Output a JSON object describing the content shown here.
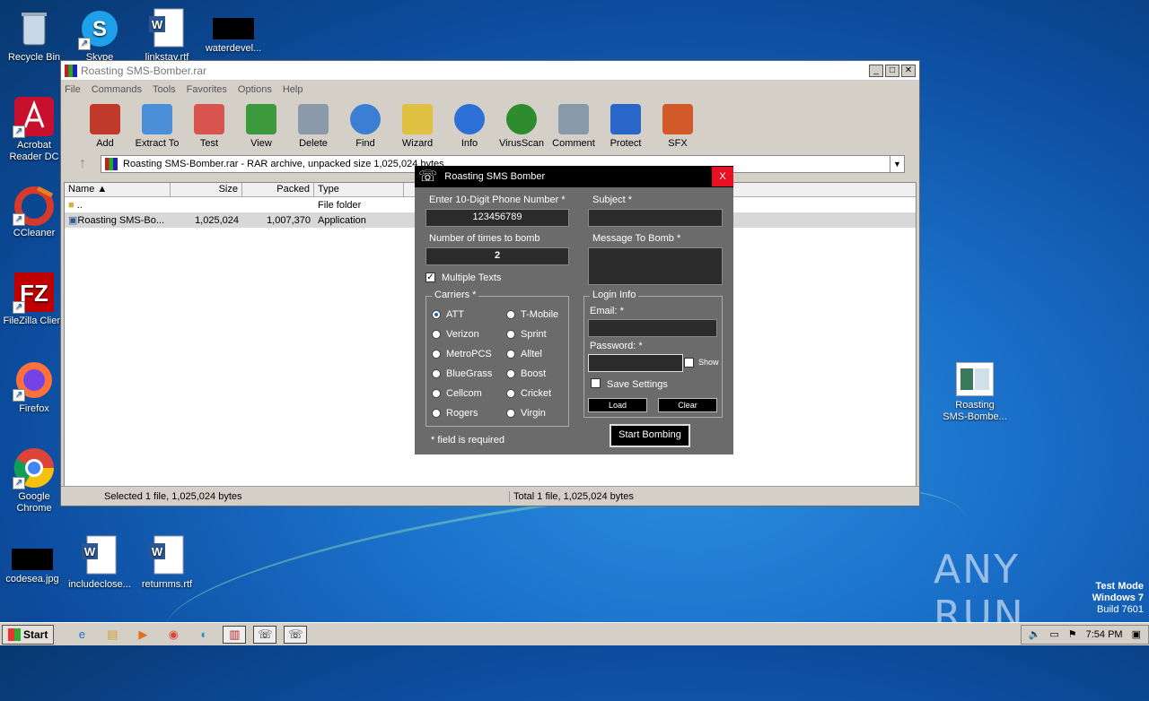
{
  "desktop": {
    "icons": [
      {
        "label": "Recycle Bin"
      },
      {
        "label": "Skype"
      },
      {
        "label": "linkstay.rtf"
      },
      {
        "label": "waterdevel..."
      },
      {
        "label": "Acrobat Reader DC"
      },
      {
        "label": "CCleaner"
      },
      {
        "label": "FileZilla Client"
      },
      {
        "label": "Firefox"
      },
      {
        "label": "Google Chrome"
      },
      {
        "label": "codesea.jpg"
      },
      {
        "label": "includeclose..."
      },
      {
        "label": "returnms.rtf"
      },
      {
        "label": "Roasting SMS-Bombe..."
      }
    ],
    "watermark": "ANY RUN",
    "test_mode": {
      "line1": "Test Mode",
      "line2": "Windows 7",
      "line3": "Build 7601"
    }
  },
  "winrar": {
    "title": "Roasting SMS-Bomber.rar",
    "window_buttons": [
      "_",
      "□",
      "✕"
    ],
    "menu": [
      "File",
      "Commands",
      "Tools",
      "Favorites",
      "Options",
      "Help"
    ],
    "toolbar": [
      {
        "label": "Add",
        "color": "#c0392b"
      },
      {
        "label": "Extract To",
        "color": "#4a8fd8"
      },
      {
        "label": "Test",
        "color": "#d9534f"
      },
      {
        "label": "View",
        "color": "#3c9a3c"
      },
      {
        "label": "Delete",
        "color": "#8a9aa8"
      },
      {
        "label": "Find",
        "color": "#3b7fd4"
      },
      {
        "label": "Wizard",
        "color": "#e0c040"
      },
      {
        "label": "Info",
        "color": "#2c6fd6"
      },
      {
        "label": "VirusScan",
        "color": "#2e8b2e"
      },
      {
        "label": "Comment",
        "color": "#8899aa"
      },
      {
        "label": "Protect",
        "color": "#2a66c8"
      },
      {
        "label": "SFX",
        "color": "#d25a2a"
      }
    ],
    "address": "Roasting SMS-Bomber.rar - RAR archive, unpacked size 1,025,024 bytes",
    "columns": [
      "Name",
      "Size",
      "Packed",
      "Type"
    ],
    "files": [
      {
        "name": "..",
        "size": "",
        "packed": "",
        "type": "File folder"
      },
      {
        "name": "Roasting SMS-Bo...",
        "size": "1,025,024",
        "packed": "1,007,370",
        "type": "Application"
      }
    ],
    "status_left": "Selected 1 file, 1,025,024 bytes",
    "status_right": "Total 1 file, 1,025,024 bytes"
  },
  "bomber": {
    "title": "Roasting SMS Bomber",
    "close": "X",
    "phone_label": "Enter 10-Digit Phone Number  *",
    "phone_value": "123456789",
    "times_label": "Number of times to bomb",
    "times_value": "2",
    "multiple_texts": "Multiple Texts",
    "subject_label": "Subject  *",
    "message_label": "Message To Bomb *",
    "carriers_label": "Carriers  *",
    "carriers_left": [
      "ATT",
      "Verizon",
      "MetroPCS",
      "BlueGrass",
      "Cellcom",
      "Rogers"
    ],
    "carriers_right": [
      "T-Mobile",
      "Sprint",
      "Alltel",
      "Boost",
      "Cricket",
      "Virgin"
    ],
    "login_label": "Login Info",
    "email_label": "Email:  *",
    "password_label": "Password: *",
    "show_label": "Show",
    "save_settings": "Save Settings",
    "load": "Load",
    "clear": "Clear",
    "required_note": "* field is required",
    "start": "Start Bombing"
  },
  "taskbar": {
    "start": "Start",
    "time": "7:54 PM"
  }
}
